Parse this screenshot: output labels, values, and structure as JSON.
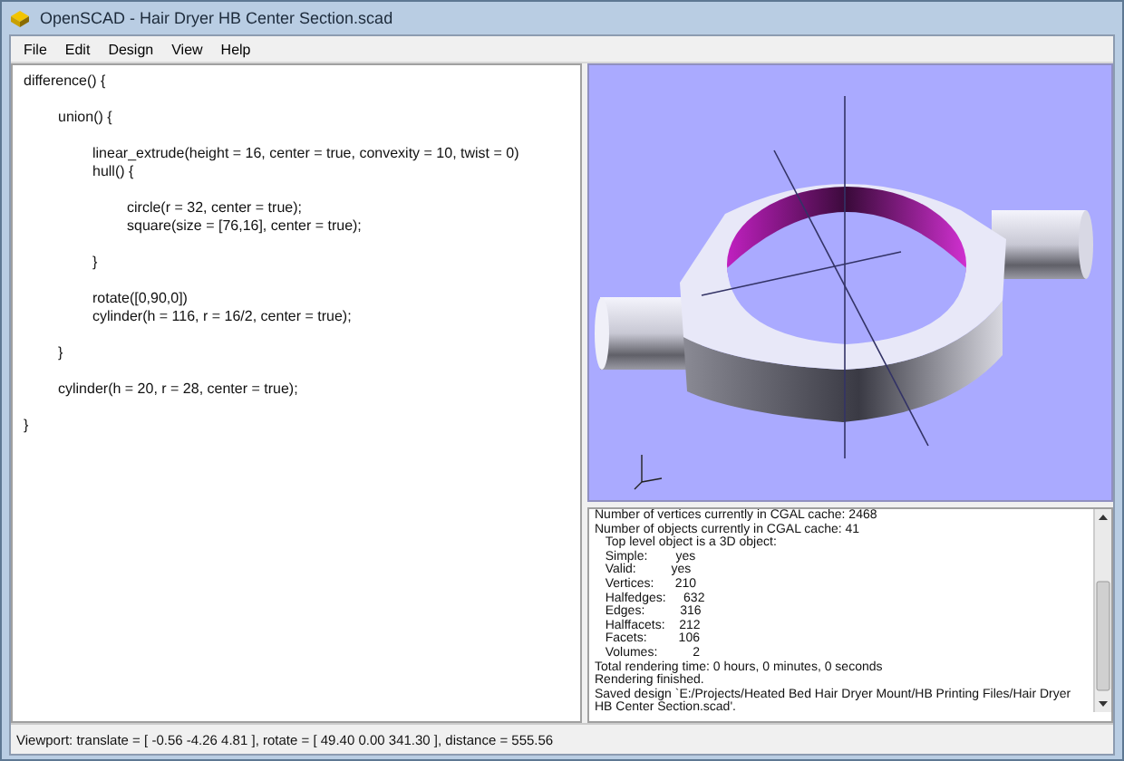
{
  "window": {
    "title": "OpenSCAD - Hair Dryer HB Center Section.scad"
  },
  "menu": [
    "File",
    "Edit",
    "Design",
    "View",
    "Help"
  ],
  "editor": {
    "blocks": [
      [
        "difference() {"
      ],
      [
        "\tunion() {"
      ],
      [
        "\t\tlinear_extrude(height = 16, center = true, convexity = 10, twist = 0)",
        "\t\thull() {"
      ],
      [
        "\t\t\tcircle(r = 32, center = true);",
        "\t\t\tsquare(size = [76,16], center = true);"
      ],
      [
        "\t\t}"
      ],
      [
        "\t\trotate([0,90,0])",
        "\t\tcylinder(h = 116, r = 16/2, center = true);"
      ],
      [
        "\t}"
      ],
      [
        "\tcylinder(h = 20, r = 28, center = true);"
      ],
      [
        "}"
      ]
    ]
  },
  "console": {
    "lines": [
      "Number of vertices currently in CGAL cache: 2468",
      "Number of objects currently in CGAL cache: 41",
      "   Top level object is a 3D object:",
      "   Simple:        yes",
      "   Valid:          yes",
      "   Vertices:      210",
      "   Halfedges:     632",
      "   Edges:          316",
      "   Halffacets:    212",
      "   Facets:         106",
      "   Volumes:          2",
      "Total rendering time: 0 hours, 0 minutes, 0 seconds",
      "Rendering finished.",
      "Saved design `E:/Projects/Heated Bed Hair Dryer Mount/HB Printing Files/Hair Dryer HB Center Section.scad'."
    ]
  },
  "status_bar": {
    "text": "Viewport: translate = [ -0.56 -4.26 4.81 ], rotate = [ 49.40 0.00 341.30 ], distance = 555.56"
  }
}
